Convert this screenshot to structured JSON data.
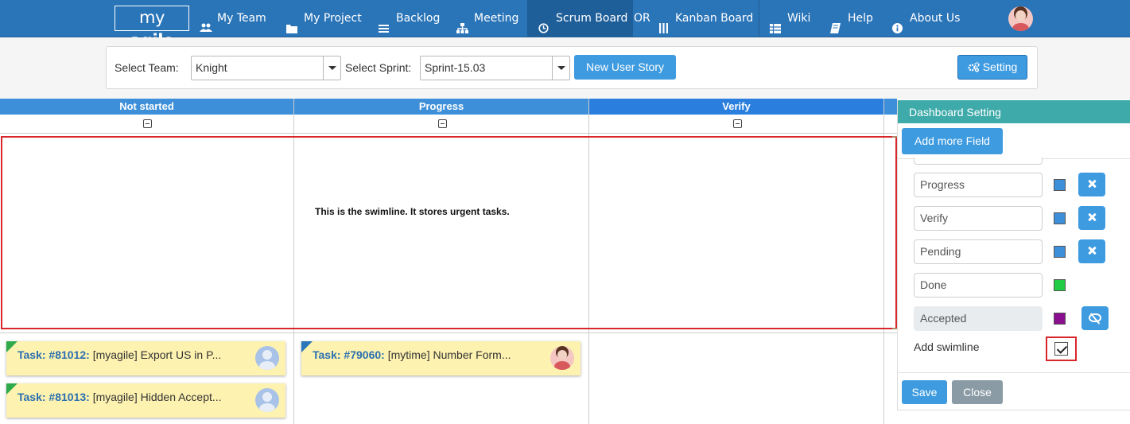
{
  "nav": {
    "logo_my": "my",
    "logo_agile": "agile",
    "items": [
      {
        "label": "My Team",
        "icon": "users-icon"
      },
      {
        "label": "My Project",
        "icon": "folder-icon"
      },
      {
        "label": "Backlog",
        "icon": "list-icon"
      },
      {
        "label": "Meeting",
        "icon": "sitemap-icon"
      },
      {
        "label": "Scrum Board",
        "icon": "clock-icon"
      },
      {
        "label": "Kanban Board",
        "icon": "columns-icon"
      },
      {
        "label": "Wiki",
        "icon": "table-icon"
      },
      {
        "label": "Help",
        "icon": "book-icon"
      },
      {
        "label": "About Us",
        "icon": "info-icon"
      }
    ],
    "or_text": "OR"
  },
  "toolbar": {
    "team_label": "Select Team:",
    "team_value": "Knight",
    "sprint_label": "Select Sprint:",
    "sprint_value": "Sprint-15.03",
    "new_story_label": "New User Story",
    "setting_label": "Setting"
  },
  "board": {
    "columns": [
      "Not started",
      "Progress",
      "Verify"
    ],
    "swimlane_note": "This is the swimline. It  stores urgent tasks.",
    "cards": [
      {
        "id": "Task: #81012:",
        "title": "[myagile] Export US in P...",
        "corner_color": "#2eaa4a"
      },
      {
        "id": "Task: #81013:",
        "title": "[myagile] Hidden Accept...",
        "corner_color": "#2eaa4a"
      },
      {
        "id": "Task: #79060:",
        "title": "[mytime] Number Form...",
        "corner_color": "#2a74b8"
      }
    ]
  },
  "settings": {
    "title": "Dashboard Setting",
    "add_field_label": "Add more Field",
    "fields": [
      {
        "label": "Progress",
        "color": "#3e8fd9"
      },
      {
        "label": "Verify",
        "color": "#3e8fd9"
      },
      {
        "label": "Pending",
        "color": "#3e8fd9"
      },
      {
        "label": "Done",
        "color": "#22cc44"
      },
      {
        "label": "Accepted",
        "color": "#8a0f8f"
      }
    ],
    "swimlane_label": "Add swimline",
    "swimlane_checked": true,
    "save_label": "Save",
    "close_label": "Close"
  }
}
